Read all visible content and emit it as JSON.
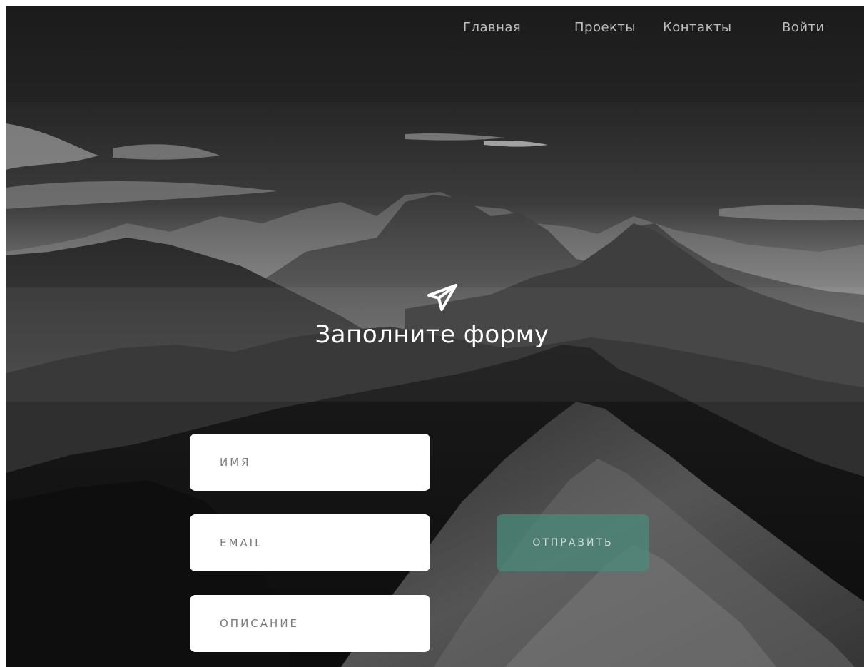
{
  "nav": {
    "items": [
      {
        "label": "Главная"
      },
      {
        "label": "Проекты"
      },
      {
        "label": "Контакты"
      },
      {
        "label": "Войти"
      }
    ]
  },
  "hero": {
    "icon": "paper-plane-icon",
    "title": "Заполните форму"
  },
  "form": {
    "fields": [
      {
        "placeholder": "ИМЯ"
      },
      {
        "placeholder": "EMAIL"
      },
      {
        "placeholder": "ОПИСАНИЕ"
      }
    ],
    "submit_label": "ОТПРАВИТЬ"
  },
  "colors": {
    "header_bg": "#1d1d1d",
    "button_bg": "#4a8b7a",
    "text_light": "#ffffff",
    "nav_text": "#bdbdbd"
  }
}
